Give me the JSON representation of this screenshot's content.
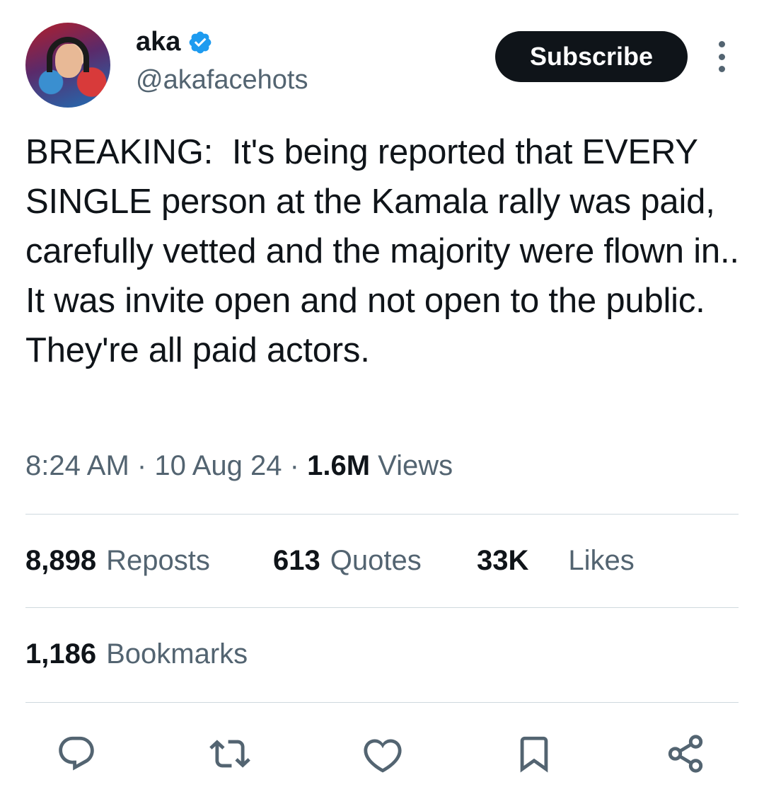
{
  "author": {
    "name": "aka",
    "handle": "@akafacehots",
    "verified": true
  },
  "header": {
    "subscribe_label": "Subscribe"
  },
  "tweet": {
    "text": "BREAKING:  It's being reported that EVERY SINGLE person at the Kamala rally was paid, carefully vetted and the majority were flown in.. It was invite open and not open to the public. They're all paid actors.",
    "time": "8:24 AM",
    "date": "10 Aug 24",
    "separator": "·",
    "views_count": "1.6M",
    "views_label": "Views"
  },
  "stats": {
    "reposts_count": "8,898",
    "reposts_label": "Reposts",
    "quotes_count": "613",
    "quotes_label": "Quotes",
    "likes_count": "33K",
    "likes_label": "Likes",
    "bookmarks_count": "1,186",
    "bookmarks_label": "Bookmarks"
  },
  "actions": [
    "reply-icon",
    "repost-icon",
    "like-icon",
    "bookmark-icon",
    "share-icon"
  ],
  "colors": {
    "text_primary": "#0f1419",
    "text_secondary": "#536471",
    "verified_blue": "#1d9bf0",
    "divider": "#cfd9de",
    "subscribe_bg": "#0f1419"
  }
}
